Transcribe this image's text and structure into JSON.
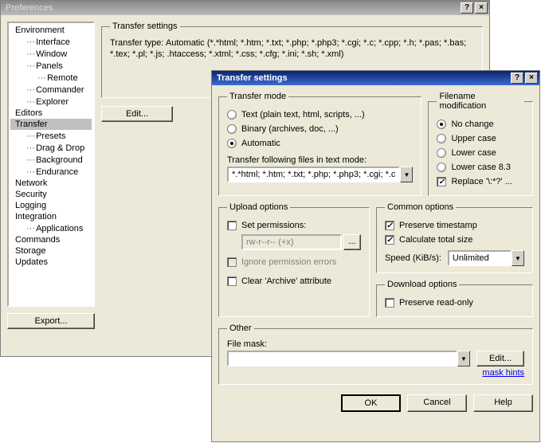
{
  "prefs": {
    "title": "Preferences",
    "tree": {
      "environment": "Environment",
      "interface": "Interface",
      "window": "Window",
      "panels": "Panels",
      "remote": "Remote",
      "commander": "Commander",
      "explorer": "Explorer",
      "editors": "Editors",
      "transfer": "Transfer",
      "presets": "Presets",
      "dragdrop": "Drag & Drop",
      "background": "Background",
      "endurance": "Endurance",
      "network": "Network",
      "security": "Security",
      "logging": "Logging",
      "integration": "Integration",
      "applications": "Applications",
      "commands": "Commands",
      "storage": "Storage",
      "updates": "Updates"
    },
    "transfer_settings_legend": "Transfer settings",
    "transfer_type_text": "Transfer type: Automatic (*.*html; *.htm; *.txt; *.php; *.php3; *.cgi; *.c; *.cpp; *.h; *.pas; *.bas; *.tex; *.pl; *.js; .htaccess; *.xtml; *.css; *.cfg; *.ini; *.sh; *.xml)",
    "edit_btn": "Edit...",
    "export_btn": "Export..."
  },
  "dlg": {
    "title": "Transfer settings",
    "mode": {
      "legend": "Transfer mode",
      "text": "Text (plain text, html, scripts, ...)",
      "binary": "Binary (archives, doc, ...)",
      "automatic": "Automatic",
      "follow_label": "Transfer following files in text mode:",
      "follow_value": "*.*html; *.htm; *.txt; *.php; *.php3; *.cgi; *.c"
    },
    "filename": {
      "legend": "Filename modification",
      "nochange": "No change",
      "upper": "Upper case",
      "lower": "Lower case",
      "lower83": "Lower case 8.3",
      "replace": "Replace '\\:*?' ..."
    },
    "upload": {
      "legend": "Upload options",
      "setperm": "Set permissions:",
      "perm_value": "rw-r--r-- (+x)",
      "ignore": "Ignore permission errors",
      "clear": "Clear 'Archive' attribute"
    },
    "common": {
      "legend": "Common options",
      "preserve": "Preserve timestamp",
      "calc": "Calculate total size",
      "speed_label": "Speed (KiB/s):",
      "speed_value": "Unlimited"
    },
    "download": {
      "legend": "Download options",
      "readonly": "Preserve read-only"
    },
    "other": {
      "legend": "Other",
      "mask_label": "File mask:",
      "edit_btn": "Edit...",
      "hints": "mask hints"
    },
    "ok": "OK",
    "cancel": "Cancel",
    "help": "Help"
  }
}
